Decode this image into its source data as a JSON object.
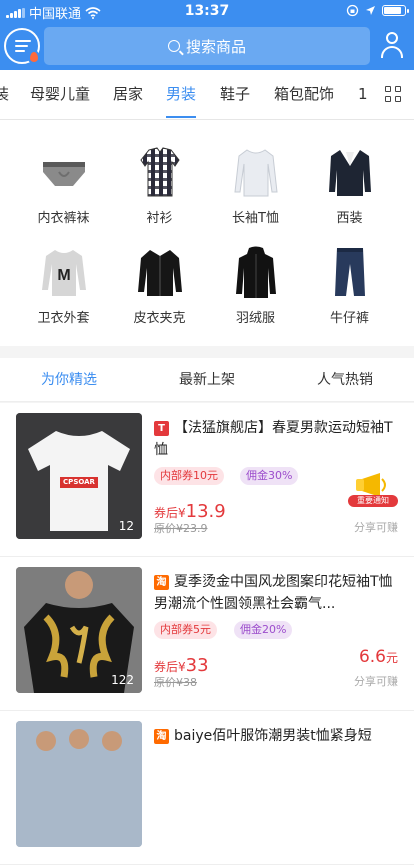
{
  "status_bar": {
    "carrier": "中国联通",
    "time": "13:37"
  },
  "search": {
    "placeholder": "搜索商品"
  },
  "category_tabs": [
    {
      "label": "装"
    },
    {
      "label": "母婴儿童"
    },
    {
      "label": "居家"
    },
    {
      "label": "男装",
      "active": true
    },
    {
      "label": "鞋子"
    },
    {
      "label": "箱包配饰"
    },
    {
      "label": "1"
    }
  ],
  "subcategories": [
    {
      "label": "内衣裤袜",
      "icon": "underwear-icon"
    },
    {
      "label": "衬衫",
      "icon": "plaid-shirt-icon"
    },
    {
      "label": "长袖T恤",
      "icon": "long-sleeve-tee-icon"
    },
    {
      "label": "西装",
      "icon": "suit-jacket-icon"
    },
    {
      "label": "卫衣外套",
      "icon": "sweatshirt-icon"
    },
    {
      "label": "皮衣夹克",
      "icon": "leather-jacket-icon"
    },
    {
      "label": "羽绒服",
      "icon": "down-coat-icon"
    },
    {
      "label": "牛仔裤",
      "icon": "jeans-icon"
    }
  ],
  "feed_tabs": [
    {
      "label": "为你精选",
      "active": true
    },
    {
      "label": "最新上架"
    },
    {
      "label": "人气热销"
    }
  ],
  "products": [
    {
      "shop_icon": "T",
      "shop_color": "#e3393c",
      "title": "【法猛旗舰店】春夏男款运动短袖T恤",
      "image_count": "12",
      "shirt_print": "CPSOAR",
      "coupon": "内部券10元",
      "commission": "佣金30%",
      "price_label": "券后",
      "price_currency": "¥",
      "price": "13.9",
      "original_price": "原价¥23.9",
      "badge_text": "重要通知",
      "share_text": "分享可赚"
    },
    {
      "shop_icon": "淘",
      "shop_color": "#ff6a00",
      "title": "夏季烫金中国风龙图案印花短袖T恤男潮流个性圆领黑社会霸气...",
      "image_count": "122",
      "coupon": "内部券5元",
      "commission": "佣金20%",
      "price_label": "券后",
      "price_currency": "¥",
      "price": "33",
      "original_price": "原价¥38",
      "earn_amount": "6.6",
      "earn_unit": "元",
      "share_text": "分享可赚"
    },
    {
      "shop_icon": "淘",
      "shop_color": "#ff6a00",
      "title": "baiye佰叶服饰潮男装t恤紧身短"
    }
  ]
}
